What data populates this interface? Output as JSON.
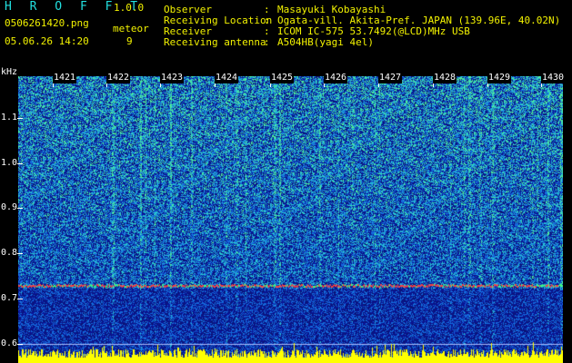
{
  "header": {
    "app_title": "H R O F F T",
    "version": "1.0.0",
    "filename": "0506261420.png",
    "datetime": "05.06.26 14:20",
    "meteor_label": "meteor",
    "meteor_count": "9"
  },
  "info": [
    {
      "label": "Observer",
      "value": "Masayuki Kobayashi"
    },
    {
      "label": "Receiving Location",
      "value": "Ogata-vill. Akita-Pref. JAPAN (139.96E, 40.02N)"
    },
    {
      "label": "Receiver",
      "value": "ICOM IC-575 53.7492(@LCD)MHz USB"
    },
    {
      "label": "Receiving antenna",
      "value": "A504HB(yagi 4el)"
    }
  ],
  "info_separator": ":",
  "axis": {
    "y_unit": "kHz",
    "y_ticks": [
      "1.1",
      "1.0",
      "0.9",
      "0.8",
      "0.7",
      "0.6"
    ],
    "x_ticks": [
      "1421",
      "1422",
      "1423",
      "1424",
      "1425",
      "1426",
      "1427",
      "1428",
      "1429",
      "1430"
    ]
  },
  "spectrogram": {
    "y_range_khz": [
      0.58,
      1.15
    ],
    "x_range_min": [
      1420.6,
      1430.2
    ],
    "carrier_khz": 0.735,
    "reference_khz": 0.618,
    "colors": {
      "background": "#000000",
      "noise_low": "#0a1a8a",
      "noise_mid": "#2a78ff",
      "noise_high": "#33d0d0",
      "signal": "#40ff80",
      "carrier": "#ff4040",
      "baseline": "#ffff00",
      "text_label": "#f2f200",
      "text_title": "#22e0e0"
    }
  }
}
